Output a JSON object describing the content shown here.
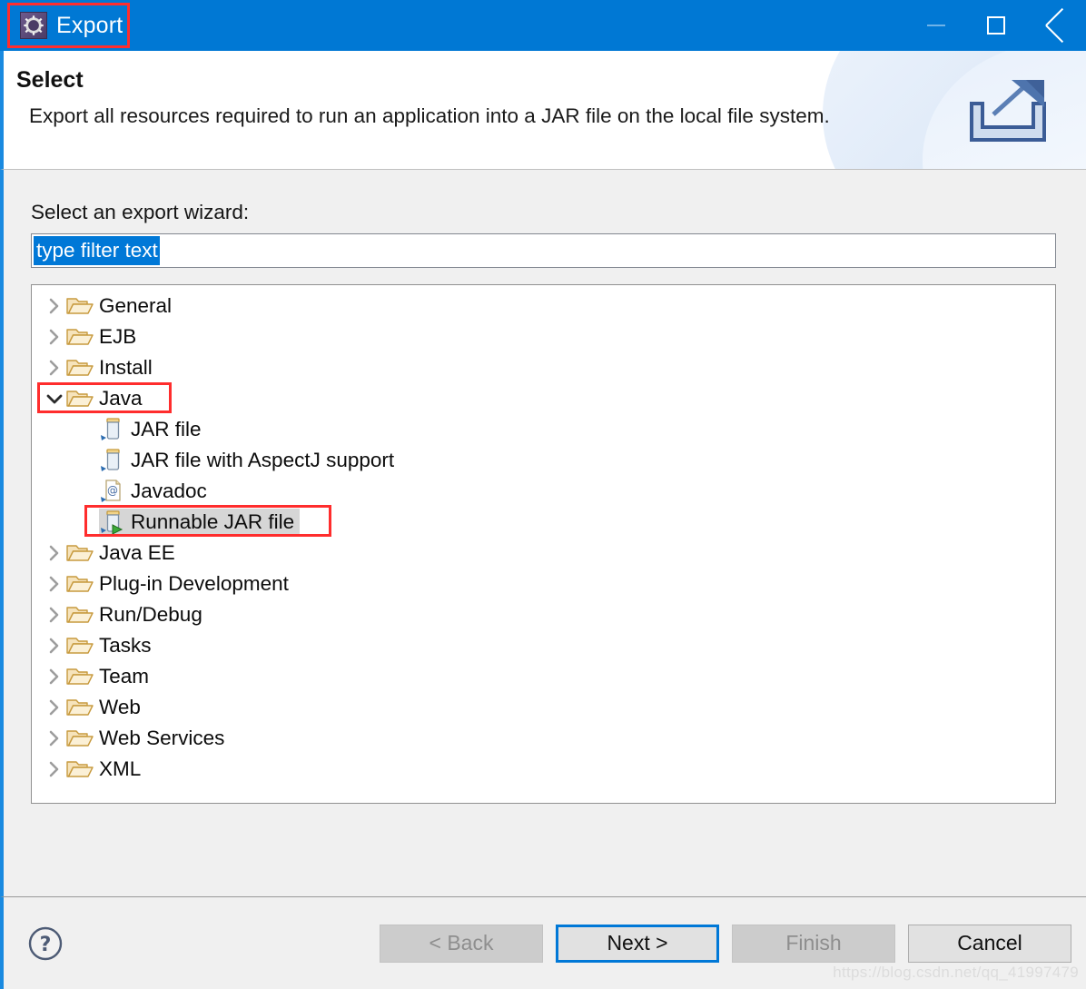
{
  "window": {
    "title": "Export",
    "title_icon": "gear-icon",
    "accent_blue": "#0078d4",
    "annotation_color": "#ff2d2d",
    "controls": {
      "minimize": "minimize-icon",
      "maximize": "maximize-icon",
      "close": "close-icon"
    }
  },
  "banner": {
    "title": "Select",
    "description": "Export all resources required to run an application into a JAR file on the local file system.",
    "icon": "export-wizard-icon"
  },
  "main": {
    "field_label": "Select an export wizard:",
    "filter": {
      "value": "type filter text",
      "placeholder": "type filter text",
      "selected": true
    },
    "tree": [
      {
        "label": "General",
        "icon": "folder-icon",
        "expanded": false,
        "level": 0
      },
      {
        "label": "EJB",
        "icon": "folder-icon",
        "expanded": false,
        "level": 0
      },
      {
        "label": "Install",
        "icon": "folder-icon",
        "expanded": false,
        "level": 0
      },
      {
        "label": "Java",
        "icon": "folder-icon",
        "expanded": true,
        "level": 0,
        "annotated": true
      },
      {
        "label": "JAR file",
        "icon": "jar-icon",
        "level": 1
      },
      {
        "label": "JAR file with AspectJ support",
        "icon": "jar-icon",
        "level": 1
      },
      {
        "label": "Javadoc",
        "icon": "javadoc-icon",
        "level": 1
      },
      {
        "label": "Runnable JAR file",
        "icon": "runnable-jar-icon",
        "level": 1,
        "selected": true,
        "annotated": true
      },
      {
        "label": "Java EE",
        "icon": "folder-icon",
        "expanded": false,
        "level": 0
      },
      {
        "label": "Plug-in Development",
        "icon": "folder-icon",
        "expanded": false,
        "level": 0
      },
      {
        "label": "Run/Debug",
        "icon": "folder-icon",
        "expanded": false,
        "level": 0
      },
      {
        "label": "Tasks",
        "icon": "folder-icon",
        "expanded": false,
        "level": 0
      },
      {
        "label": "Team",
        "icon": "folder-icon",
        "expanded": false,
        "level": 0
      },
      {
        "label": "Web",
        "icon": "folder-icon",
        "expanded": false,
        "level": 0
      },
      {
        "label": "Web Services",
        "icon": "folder-icon",
        "expanded": false,
        "level": 0
      },
      {
        "label": "XML",
        "icon": "folder-icon",
        "expanded": false,
        "level": 0
      }
    ]
  },
  "footer": {
    "help": "?",
    "buttons": {
      "back": "< Back",
      "next": "Next >",
      "finish": "Finish",
      "cancel": "Cancel"
    },
    "back_enabled": false,
    "next_enabled": true,
    "finish_enabled": false,
    "cancel_enabled": true,
    "watermark": "https://blog.csdn.net/qq_41997479"
  }
}
